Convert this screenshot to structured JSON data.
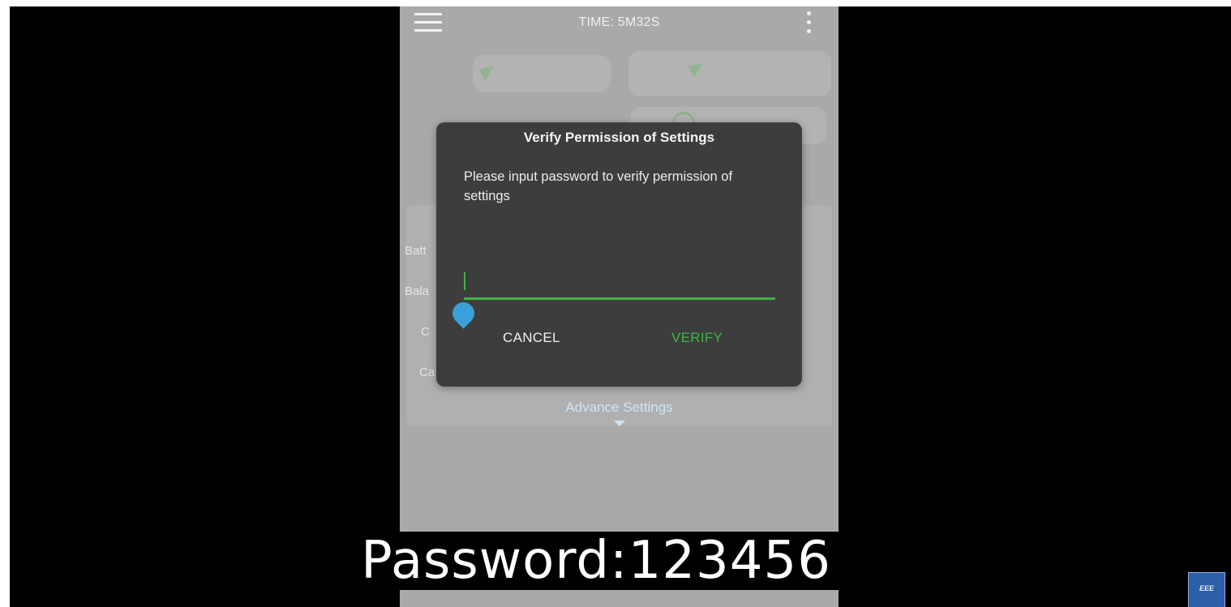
{
  "topbar": {
    "time_label": "TIME: 5M32S",
    "menu_icon": "hamburger-menu-icon",
    "overflow_icon": "more-vertical-icon"
  },
  "background": {
    "labels": [
      "Batt",
      "Bala",
      "C",
      "Ca"
    ],
    "advance_settings": "Advance Settings"
  },
  "dialog": {
    "title": "Verify Permission of Settings",
    "message": "Please input password to verify permission of settings",
    "password_value": "",
    "cancel_label": "CANCEL",
    "verify_label": "VERIFY"
  },
  "caption": "Password:123456",
  "colors": {
    "accent_green": "#43b14a",
    "handle_blue": "#3aa0d8",
    "dialog_bg": "#3d3d3d",
    "scrim": "#a9a9a9"
  }
}
